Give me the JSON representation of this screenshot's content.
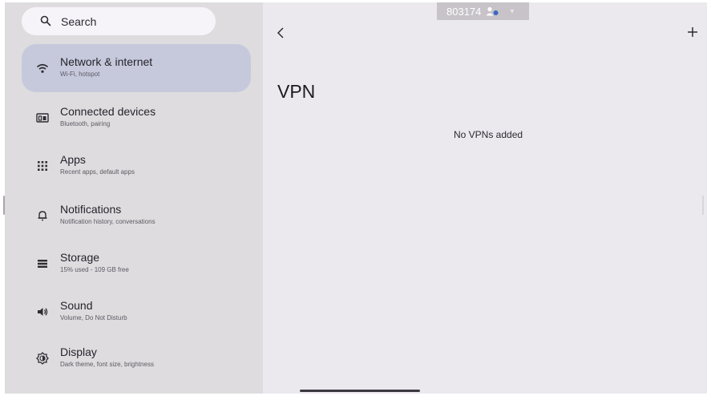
{
  "search": {
    "label": "Search"
  },
  "sidebar": {
    "items": [
      {
        "title": "Network & internet",
        "subtitle": "Wi-Fi, hotspot",
        "icon": "wifi-icon",
        "active": true
      },
      {
        "title": "Connected devices",
        "subtitle": "Bluetooth, pairing",
        "icon": "devices-icon",
        "active": false
      },
      {
        "title": "Apps",
        "subtitle": "Recent apps, default apps",
        "icon": "apps-grid-icon",
        "active": false
      },
      {
        "title": "Notifications",
        "subtitle": "Notification history, conversations",
        "icon": "bell-icon",
        "active": false
      },
      {
        "title": "Storage",
        "subtitle": "15% used - 109 GB free",
        "icon": "storage-icon",
        "active": false
      },
      {
        "title": "Sound",
        "subtitle": "Volume, Do Not Disturb",
        "icon": "volume-icon",
        "active": false
      },
      {
        "title": "Display",
        "subtitle": "Dark theme, font size, brightness",
        "icon": "brightness-icon",
        "active": false
      }
    ]
  },
  "recording_badge": {
    "id": "803174"
  },
  "main": {
    "title": "VPN",
    "empty_text": "No VPNs added"
  },
  "colors": {
    "sidebar_bg": "#dedcdf",
    "active_item_bg": "#c6c9dc",
    "content_bg": "#ece9ee",
    "search_bg": "#f6f4f8"
  }
}
